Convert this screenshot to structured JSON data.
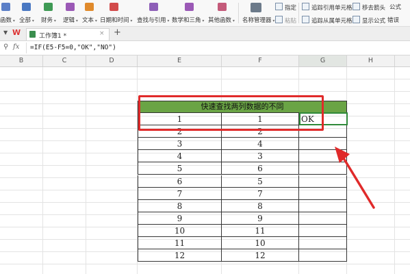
{
  "ribbon": {
    "items": [
      "函数",
      "全部",
      "财务",
      "逻辑",
      "文本",
      "日期和时间",
      "查找与引用",
      "数学和三角",
      "其他函数",
      "名称管理器"
    ],
    "specify": "指定",
    "paste": "粘贴",
    "trace_precedents": "追踪引用单元格",
    "trace_dependents": "追踪从属单元格",
    "remove_arrows": "移去箭头",
    "formula": "公式",
    "show_formula": "显示公式",
    "error_check": "错误"
  },
  "tabs": {
    "doc_name": "工作簿1 *",
    "add": "+"
  },
  "formula_bar": {
    "fx": "fx",
    "content": "=IF(E5-F5=0,\"OK\",\"NO\")"
  },
  "columns": [
    "B",
    "C",
    "D",
    "E",
    "F",
    "G",
    "H"
  ],
  "table": {
    "title": "快速查找两列数据的不同",
    "rows": [
      {
        "e": "1",
        "f": "1",
        "g": "OK"
      },
      {
        "e": "2",
        "f": "2",
        "g": ""
      },
      {
        "e": "3",
        "f": "4",
        "g": ""
      },
      {
        "e": "4",
        "f": "3",
        "g": ""
      },
      {
        "e": "5",
        "f": "6",
        "g": ""
      },
      {
        "e": "6",
        "f": "5",
        "g": ""
      },
      {
        "e": "7",
        "f": "7",
        "g": ""
      },
      {
        "e": "8",
        "f": "8",
        "g": ""
      },
      {
        "e": "9",
        "f": "9",
        "g": ""
      },
      {
        "e": "10",
        "f": "11",
        "g": ""
      },
      {
        "e": "11",
        "f": "10",
        "g": ""
      },
      {
        "e": "12",
        "f": "12",
        "g": ""
      }
    ]
  },
  "colors": {
    "header_fill": "#6aa445",
    "highlight": "#e02a2a",
    "active_border": "#2f8a3a"
  }
}
